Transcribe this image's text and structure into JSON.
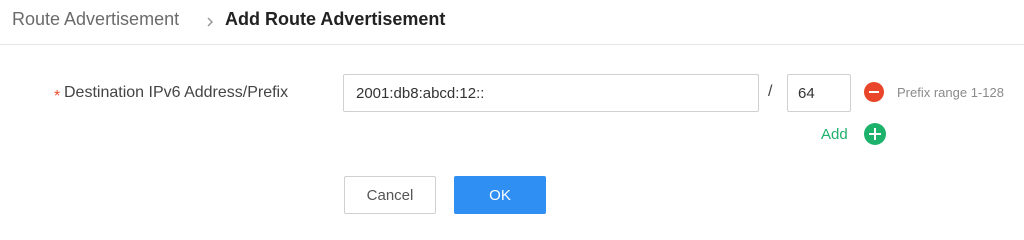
{
  "breadcrumb": {
    "parent": "Route Advertisement",
    "current": "Add Route Advertisement"
  },
  "form": {
    "required_mark": "*",
    "destination_label": "Destination IPv6 Address/Prefix",
    "address_value": "2001:db8:abcd:12::",
    "separator": "/",
    "prefix_value": "64",
    "prefix_hint": "Prefix range 1-128",
    "add_label": "Add"
  },
  "actions": {
    "cancel_label": "Cancel",
    "ok_label": "OK"
  },
  "colors": {
    "required": "#e8502e",
    "remove": "#e8452a",
    "add": "#1db26b",
    "primary": "#2f8ff2"
  },
  "icons": {
    "separator": "chevron-right-icon",
    "remove": "minus-circle-icon",
    "add": "plus-circle-icon"
  }
}
